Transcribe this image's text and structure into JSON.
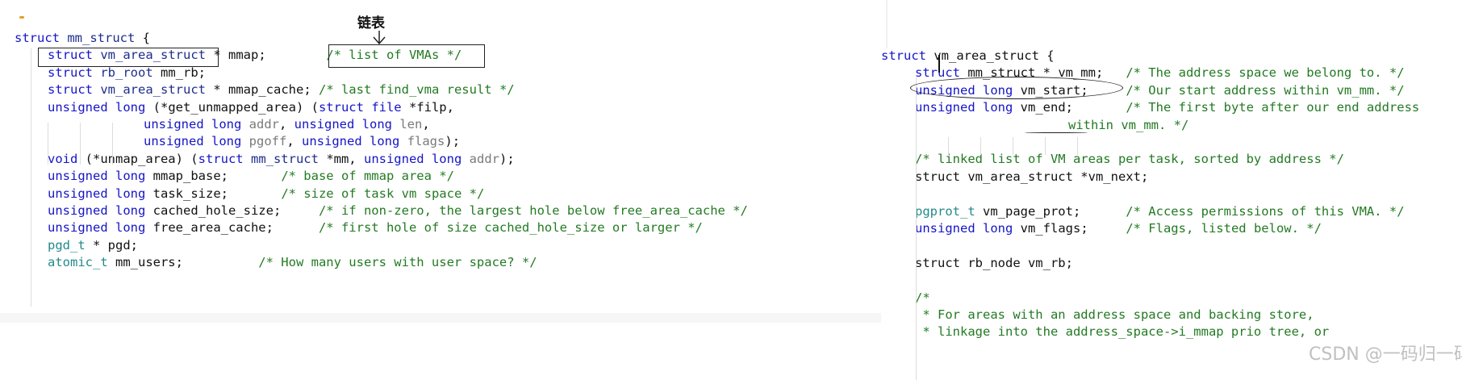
{
  "annotation": {
    "label": "链表"
  },
  "watermark": "CSDN @一码归一码",
  "left": {
    "lines": [
      [
        [
          "kw",
          "struct"
        ],
        [
          "id",
          " "
        ],
        [
          "ty",
          "mm_struct"
        ],
        [
          "id",
          " {"
        ]
      ],
      [
        [
          "kw",
          "struct"
        ],
        [
          "id",
          " "
        ],
        [
          "ty",
          "vm_area_struct"
        ],
        [
          "id",
          " * mmap;        "
        ],
        [
          "cm",
          "/* list of VMAs */"
        ]
      ],
      [
        [
          "kw",
          "struct"
        ],
        [
          "id",
          " "
        ],
        [
          "ty",
          "rb_root"
        ],
        [
          "id",
          " mm_rb;"
        ]
      ],
      [
        [
          "kw",
          "struct"
        ],
        [
          "id",
          " "
        ],
        [
          "ty",
          "vm_area_struct"
        ],
        [
          "id",
          " * mmap_cache; "
        ],
        [
          "cm",
          "/* last find_vma result */"
        ]
      ],
      [
        [
          "kw",
          "unsigned long"
        ],
        [
          "id",
          " (*get_unmapped_area) ("
        ],
        [
          "kw",
          "struct"
        ],
        [
          "id",
          " "
        ],
        [
          "kw",
          "file"
        ],
        [
          "id",
          " *filp,"
        ]
      ],
      [
        [
          "kw",
          "unsigned long"
        ],
        [
          "id",
          " "
        ],
        [
          "gray",
          "addr"
        ],
        [
          "id",
          ", "
        ],
        [
          "kw",
          "unsigned long"
        ],
        [
          "id",
          " "
        ],
        [
          "gray",
          "len"
        ],
        [
          "id",
          ","
        ]
      ],
      [
        [
          "kw",
          "unsigned long"
        ],
        [
          "id",
          " "
        ],
        [
          "gray",
          "pgoff"
        ],
        [
          "id",
          ", "
        ],
        [
          "kw",
          "unsigned long"
        ],
        [
          "id",
          " "
        ],
        [
          "gray",
          "flags"
        ],
        [
          "id",
          ");"
        ]
      ],
      [
        [
          "kw",
          "void"
        ],
        [
          "id",
          " (*unmap_area) ("
        ],
        [
          "kw",
          "struct"
        ],
        [
          "id",
          " "
        ],
        [
          "ty",
          "mm_struct"
        ],
        [
          "id",
          " *mm, "
        ],
        [
          "kw",
          "unsigned long"
        ],
        [
          "id",
          " "
        ],
        [
          "gray",
          "addr"
        ],
        [
          "id",
          ");"
        ]
      ],
      [
        [
          "kw",
          "unsigned long"
        ],
        [
          "id",
          " mmap_base;       "
        ],
        [
          "cm",
          "/* base of mmap area */"
        ]
      ],
      [
        [
          "kw",
          "unsigned long"
        ],
        [
          "id",
          " task_size;       "
        ],
        [
          "cm",
          "/* size of task vm space */"
        ]
      ],
      [
        [
          "kw",
          "unsigned long"
        ],
        [
          "id",
          " cached_hole_size;     "
        ],
        [
          "cm",
          "/* if non-zero, the largest hole below free_area_cache */"
        ]
      ],
      [
        [
          "kw",
          "unsigned long"
        ],
        [
          "id",
          " free_area_cache;      "
        ],
        [
          "cm",
          "/* first hole of size cached_hole_size or larger */"
        ]
      ],
      [
        [
          "tp",
          "pgd_t"
        ],
        [
          "id",
          " * pgd;"
        ]
      ],
      [
        [
          "tp",
          "atomic_t"
        ],
        [
          "id",
          " mm_users;          "
        ],
        [
          "cm",
          "/* How many users with user space? */"
        ]
      ]
    ]
  },
  "right": {
    "lines": [
      [
        [
          "kw",
          "struct"
        ],
        [
          "id",
          " vm_area_struct {"
        ]
      ],
      [
        [
          "kw",
          "struct"
        ],
        [
          "id",
          " mm_struct * vm_mm;   "
        ],
        [
          "cm",
          "/* The address space we belong to. */"
        ]
      ],
      [
        [
          "kw",
          "unsigned long"
        ],
        [
          "id",
          " vm_start;     "
        ],
        [
          "cm",
          "/* Our start address within vm_mm. */"
        ]
      ],
      [
        [
          "kw",
          "unsigned long"
        ],
        [
          "id",
          " vm_end;       "
        ],
        [
          "cm",
          "/* The first byte after our end address"
        ]
      ],
      [
        [
          "cm",
          "within vm_mm. */"
        ]
      ],
      [],
      [
        [
          "cm",
          "/* linked list of VM areas per task, sorted by address */"
        ]
      ],
      [
        [
          "id",
          "struct vm_area_struct *vm_next;"
        ]
      ],
      [],
      [
        [
          "tp",
          "pgprot_t"
        ],
        [
          "id",
          " vm_page_prot;      "
        ],
        [
          "cm",
          "/* Access permissions of this VMA. */"
        ]
      ],
      [
        [
          "kw",
          "unsigned long"
        ],
        [
          "id",
          " vm_flags;     "
        ],
        [
          "cm",
          "/* Flags, listed below. */"
        ]
      ],
      [],
      [
        [
          "id",
          "struct rb_node vm_rb;"
        ]
      ],
      [],
      [
        [
          "cm",
          "/*"
        ]
      ],
      [
        [
          "cm",
          " * For areas with an address space and backing store,"
        ]
      ],
      [
        [
          "cm",
          " * linkage into the address_space->i_mmap prio tree, or"
        ]
      ]
    ]
  }
}
